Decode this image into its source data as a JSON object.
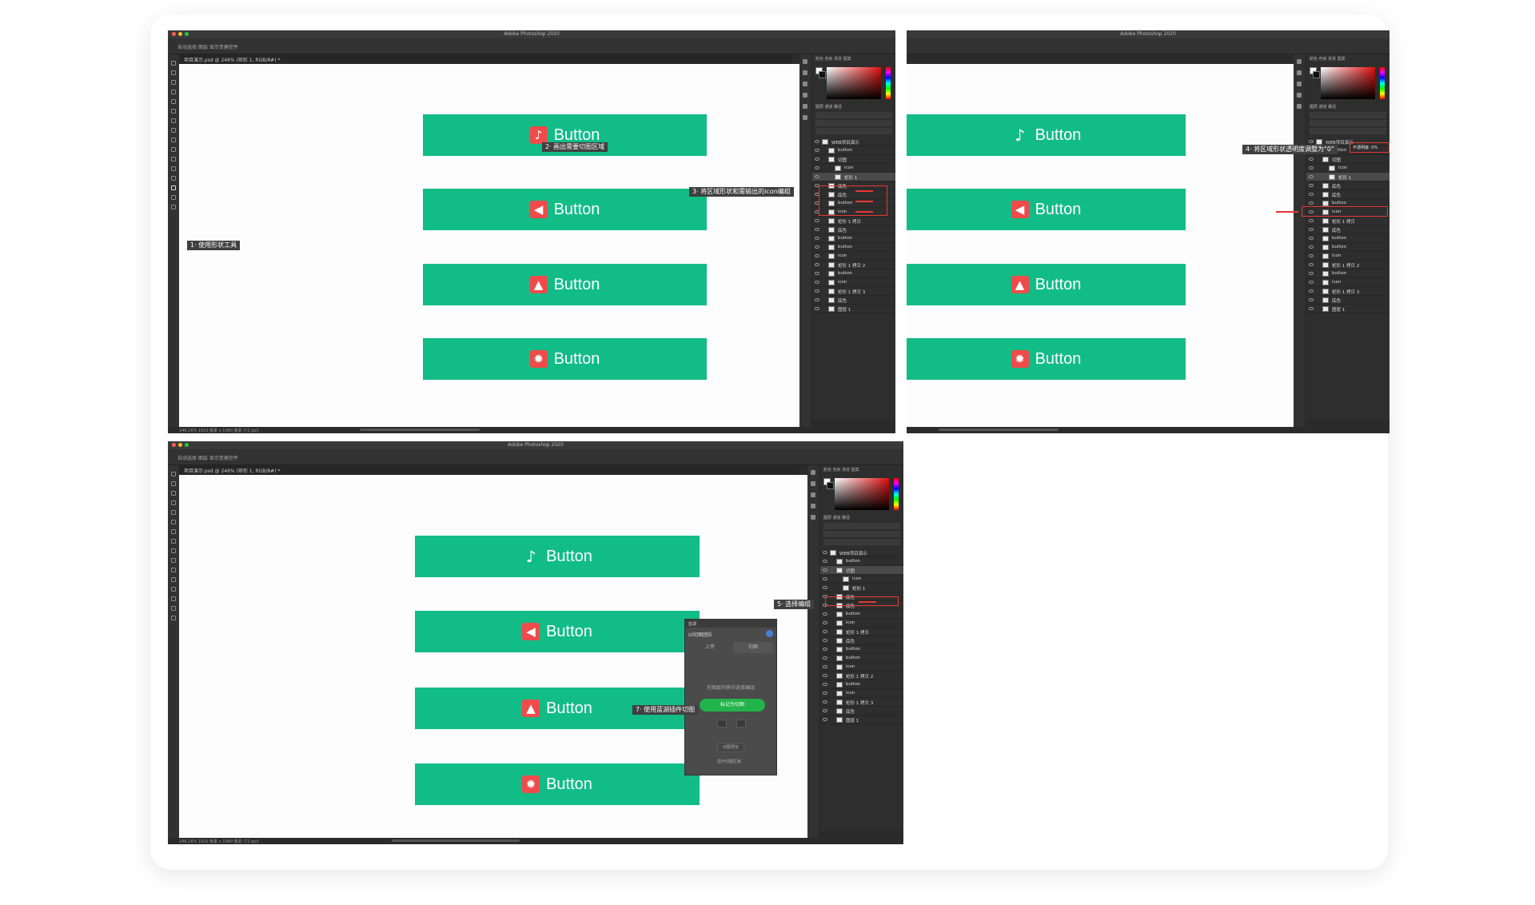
{
  "app_title": "Adobe Photoshop 2020",
  "doc_tab": "项目演示.psd @ 246% (矩形 1, RGB/8#) *",
  "options_bar_text": "自动选择  图层  显示变换控件",
  "status_text": "246.16%   1920 像素 x 1080 像素 (72 ppi)",
  "panel_tabs": "颜色   色板   渐变   图案",
  "layer_tabs": "图层   通道   路径",
  "button_label": "Button",
  "icons": [
    "bell-icon",
    "speaker-icon",
    "warning-icon",
    "gear-icon"
  ],
  "annotations": {
    "step1": "1· 使用形状工具",
    "step2": "2· 画出需要切图区域",
    "step3": "3· 将区域形状和需输出的icon编组",
    "step4": "4· 将区域形状透明度调整为\"0\"",
    "step5": "5· 选择编组",
    "step7": "7· 使用蓝湖插件切图"
  },
  "layers": {
    "panel1": [
      "WEB项目演示",
      "button",
      "切图",
      "icon",
      "矩形 1",
      "底色",
      "底色",
      "button",
      "icon",
      "矩形 1 拷贝",
      "底色",
      "button",
      "button",
      "icon",
      "矩形 1 拷贝 2",
      "button",
      "icon",
      "矩形 1 拷贝 3",
      "底色",
      "图层 1"
    ],
    "panel2": [
      "WEB项目演示",
      "button",
      "切图",
      "icon",
      "矩形 1",
      "底色",
      "底色",
      "button",
      "icon",
      "矩形 1 拷贝",
      "底色",
      "button",
      "button",
      "icon",
      "矩形 1 拷贝 2",
      "button",
      "icon",
      "矩形 1 拷贝 3",
      "底色",
      "图层 1"
    ],
    "panel3": [
      "WEB项目演示",
      "button",
      "切图",
      "icon",
      "矩形 1",
      "底色",
      "底色",
      "button",
      "icon",
      "矩形 1 拷贝",
      "底色",
      "button",
      "button",
      "icon",
      "矩形 1 拷贝 2",
      "button",
      "icon",
      "矩形 1 拷贝 3",
      "底色",
      "图层 1"
    ]
  },
  "opacity_field": "不透明度: 0%",
  "plugin": {
    "title": "蓝湖",
    "team": "UI切图团队",
    "tab_upload": "上传",
    "tab_slice": "切图",
    "hint": "在图层列表中选择编组",
    "mark_button": "标记为切图",
    "secondary_button": "切图预览",
    "checkbox_label": "显示切图区域"
  },
  "colors": {
    "button_green": "#12bc86",
    "icon_red": "#f04a4a",
    "highlight_red": "#e53935",
    "plugin_green": "#23b34b"
  }
}
